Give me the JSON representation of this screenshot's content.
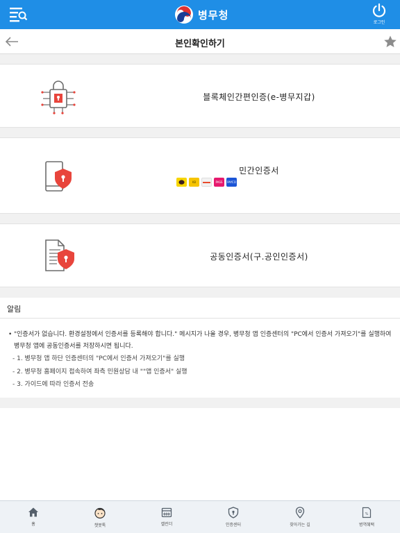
{
  "header": {
    "logo_text": "병무청",
    "login_label": "로그인"
  },
  "titlebar": {
    "title": "본인확인하기"
  },
  "cards": [
    {
      "label": "블록체인간편인증(e-병무지갑)",
      "icon": "blockchain-lock-icon"
    },
    {
      "label": "민간인증서",
      "icon": "phone-shield-icon",
      "badges": [
        {
          "name": "kakao",
          "text": "",
          "color": "#f7d500"
        },
        {
          "name": "kb",
          "text": "KB",
          "color": "#f6c400"
        },
        {
          "name": "toss",
          "text": "",
          "color": "#f2f2f2"
        },
        {
          "name": "pass",
          "text": "PASS",
          "color": "#e6196e"
        },
        {
          "name": "payco",
          "text": "PAYCO",
          "color": "#1c55d6"
        }
      ]
    },
    {
      "label": "공동인증서(구.공인인증서)",
      "icon": "document-shield-icon"
    }
  ],
  "notice": {
    "title": "알림",
    "main": "\"인증서가 없습니다. 환경설정에서 인증서를 등록해야 합니다.\" 메시지가 나올 경우, 병무청 앱 인증센터의 \"PC에서 인증서 가져오기\"를 실행하여 병무청 앱에 공동인증서를 저장하시면 됩니다.",
    "bullet": "•",
    "steps": [
      "- 1. 병무청 앱 하단 인증센터의 \"PC에서 인증서 가져오기\"를 실행",
      "- 2. 병무청 홈페이지 접속하여 좌측 민원상담 내 \"\"앱 인증서\" 실행",
      "- 3. 가이드에 따라 인증서 전송"
    ]
  },
  "tabs": [
    {
      "label": "홈",
      "icon": "home-icon"
    },
    {
      "label": "챗봇톡",
      "icon": "chatbot-icon"
    },
    {
      "label": "캘린더",
      "icon": "calendar-icon"
    },
    {
      "label": "인증센터",
      "icon": "shield-icon"
    },
    {
      "label": "찾아가는 길",
      "icon": "location-pin-icon"
    },
    {
      "label": "병역혜택",
      "icon": "benefit-document-icon"
    }
  ],
  "colors": {
    "header_bg": "#1f8ee6",
    "accent_red": "#e8453c",
    "icon_gray": "#6b6b6b"
  }
}
